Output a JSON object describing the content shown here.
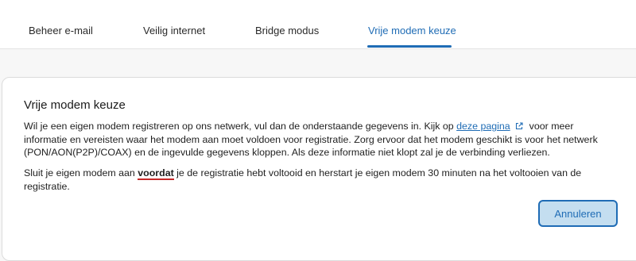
{
  "tabs": [
    {
      "label": "Beheer e-mail",
      "active": false
    },
    {
      "label": "Veilig internet",
      "active": false
    },
    {
      "label": "Bridge modus",
      "active": false
    },
    {
      "label": "Vrije modem keuze",
      "active": true
    }
  ],
  "card": {
    "title": "Vrije modem keuze",
    "paragraph1": {
      "before_link": "Wil je een eigen modem registreren op ons netwerk, vul dan de onderstaande gegevens in. Kijk op ",
      "link_text": "deze pagina",
      "link_icon": "external-link-icon",
      "after_link": "voor meer informatie en vereisten waar het modem aan moet voldoen voor registratie. Zorg ervoor dat het modem geschikt is voor het netwerk (PON/AON(P2P)/COAX) en de ingevulde gegevens kloppen. Als deze informatie niet klopt zal je de verbinding verliezen."
    },
    "paragraph2": {
      "before": "Sluit je eigen modem aan ",
      "emphasis": "voordat",
      "after": " je de registratie hebt voltooid en herstart je eigen modem 30 minuten na het voltooien van de registratie."
    },
    "cancel_label": "Annuleren"
  },
  "colors": {
    "accent": "#1f6cb5",
    "emphasis_underline": "#c62828",
    "button_bg": "#c4def0"
  }
}
